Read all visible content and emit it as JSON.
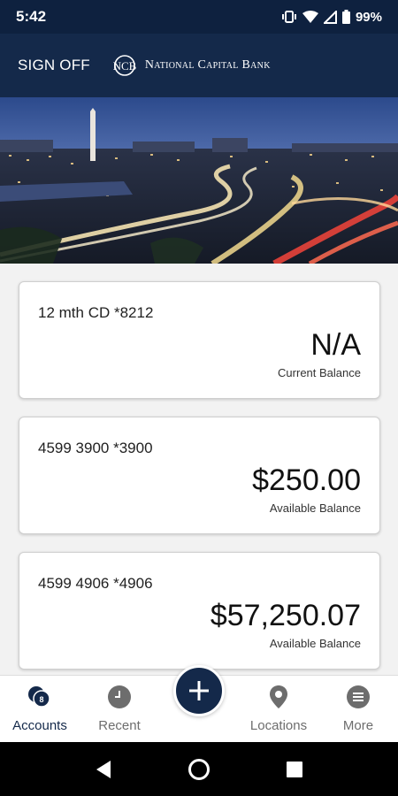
{
  "status_bar": {
    "time": "5:42",
    "battery": "99%",
    "icons": [
      "vibrate-icon",
      "wifi-icon",
      "signal-icon",
      "battery-icon"
    ]
  },
  "header": {
    "sign_off": "SIGN OFF",
    "logo_monogram": "NCB",
    "bank_name": "National Capital Bank"
  },
  "accounts": [
    {
      "name": "12 mth CD *8212",
      "amount": "N/A",
      "label": "Current Balance"
    },
    {
      "name": "4599 3900 *3900",
      "amount": "$250.00",
      "label": "Available Balance"
    },
    {
      "name": "4599 4906 *4906",
      "amount": "$57,250.07",
      "label": "Available Balance"
    }
  ],
  "bottom_nav": {
    "accounts": {
      "label": "Accounts",
      "badge": "8",
      "icon": "accounts-icon"
    },
    "recent": {
      "label": "Recent",
      "icon": "clock-icon"
    },
    "add": {
      "icon": "plus-icon"
    },
    "locations": {
      "label": "Locations",
      "icon": "location-pin-icon"
    },
    "more": {
      "label": "More",
      "icon": "more-icon"
    }
  },
  "colors": {
    "brand_navy": "#14294a",
    "status_bar": "#0e213f",
    "inactive_gray": "#6d6d6d"
  }
}
